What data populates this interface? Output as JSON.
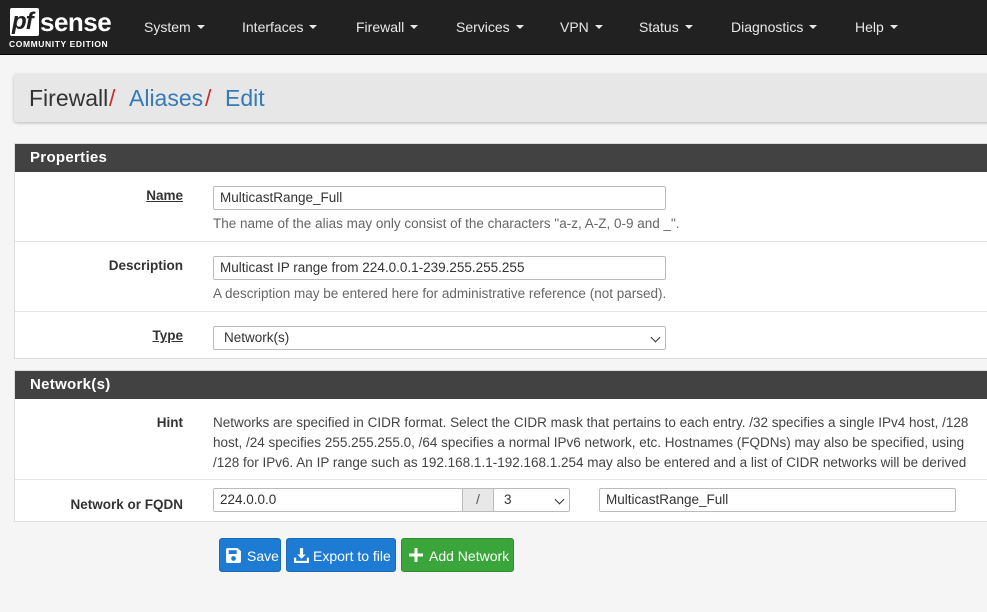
{
  "brand": {
    "logo_pf": "pf",
    "logo_sense": "sense",
    "edition": "COMMUNITY EDITION"
  },
  "nav": {
    "items": [
      {
        "label": "System"
      },
      {
        "label": "Interfaces"
      },
      {
        "label": "Firewall"
      },
      {
        "label": "Services"
      },
      {
        "label": "VPN"
      },
      {
        "label": "Status"
      },
      {
        "label": "Diagnostics"
      },
      {
        "label": "Help"
      }
    ]
  },
  "breadcrumb": {
    "root": "Firewall",
    "sep": "/",
    "aliases": "Aliases",
    "edit": "Edit"
  },
  "properties": {
    "heading": "Properties",
    "name_label": "Name",
    "name_value": "MulticastRange_Full",
    "name_help": "The name of the alias may only consist of the characters \"a-z, A-Z, 0-9 and _\".",
    "description_label": "Description",
    "description_value": "Multicast IP range from 224.0.0.1-239.255.255.255",
    "description_help": "A description may be entered here for administrative reference (not parsed).",
    "type_label": "Type",
    "type_value": "Network(s)"
  },
  "networks": {
    "heading": "Network(s)",
    "hint_label": "Hint",
    "hint_lines": [
      "Networks are specified in CIDR format. Select the CIDR mask that pertains to each entry. /32 specifies a single IPv4 host, /128",
      "host, /24 specifies 255.255.255.0, /64 specifies a normal IPv6 network, etc. Hostnames (FQDNs) may also be specified, using",
      "/128 for IPv6. An IP range such as 192.168.1.1-192.168.1.254 may also be entered and a list of CIDR networks will be derived"
    ],
    "row_label": "Network or FQDN",
    "network_value": "224.0.0.0",
    "slash": "/",
    "cidr_value": "3",
    "entry_description": "MulticastRange_Full"
  },
  "buttons": {
    "save": "Save",
    "export": "Export to file",
    "add_network": "Add Network"
  },
  "colors": {
    "navbar": "#212121",
    "panel_heading": "#424242",
    "link": "#337ab7",
    "separator": "#c9302c",
    "primary": "#1e7bd3",
    "success": "#3aa53a"
  }
}
